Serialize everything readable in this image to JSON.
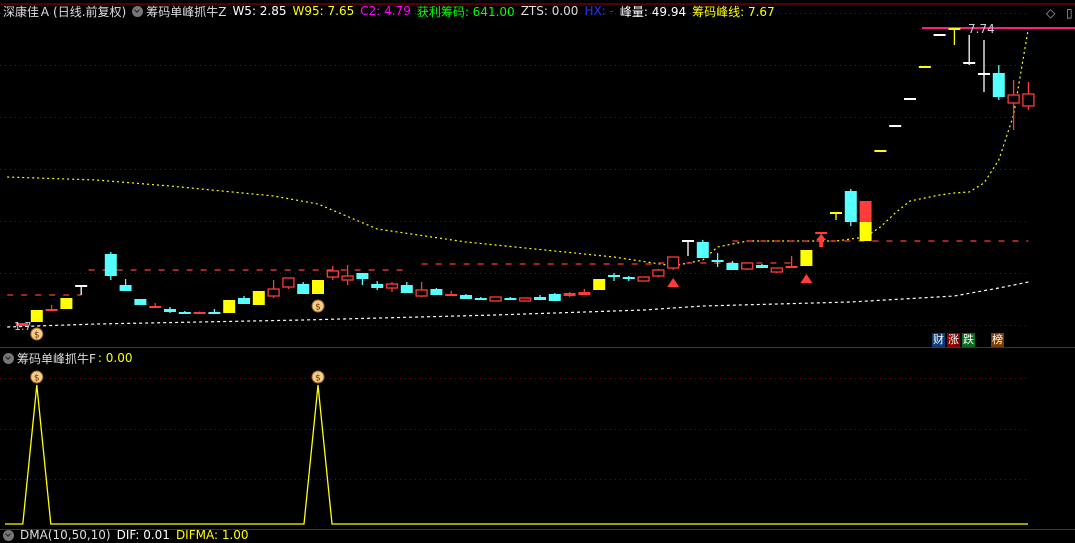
{
  "header": {
    "stock": "深康佳Ａ",
    "period": "(日线.前复权)",
    "indicator_name": "筹码单峰抓牛Z",
    "w5": "W5: 2.85",
    "w95": "W95: 7.65",
    "c2": "C2: 4.79",
    "profit_chips": "获利筹码: 641.00",
    "zts": "ZTS: 0.00",
    "hx": "HX: -",
    "peak_volume": "峰量: 49.94",
    "peak_line": "筹码峰线: 7.67"
  },
  "colors": {
    "up": "#ff3b3b",
    "down": "#55ffff",
    "yellow": "#ffff00",
    "white": "#ffffff",
    "magenta": "#ff1a8c",
    "grid": "#8b0000"
  },
  "main_chart": {
    "high_label": "7.74",
    "low_label": "1.7",
    "price_top": 8.3,
    "candles": [
      [
        1.84,
        1.78,
        1.84,
        1.78,
        "r"
      ],
      [
        2.1,
        1.86,
        2.1,
        1.86,
        "y"
      ],
      [
        2.12,
        2.08,
        2.2,
        2.08,
        "r"
      ],
      [
        2.34,
        2.12,
        2.34,
        2.12,
        "y"
      ],
      [
        2.6,
        2.58,
        2.6,
        2.4,
        "w"
      ],
      null,
      [
        3.22,
        2.78,
        3.26,
        2.7,
        "c"
      ],
      [
        2.6,
        2.48,
        2.72,
        2.48,
        "c"
      ],
      [
        2.32,
        2.2,
        2.32,
        2.2,
        "c"
      ],
      [
        2.18,
        2.14,
        2.24,
        2.14,
        "r"
      ],
      [
        2.12,
        2.06,
        2.16,
        2.04,
        "c"
      ],
      [
        2.06,
        2.04,
        2.08,
        2.02,
        "c"
      ],
      [
        2.06,
        2.04,
        2.07,
        2.03,
        "r"
      ],
      [
        2.06,
        2.04,
        2.12,
        2.04,
        "c"
      ],
      [
        2.3,
        2.04,
        2.3,
        2.04,
        "y"
      ],
      [
        2.34,
        2.22,
        2.38,
        2.22,
        "c"
      ],
      [
        2.48,
        2.2,
        2.48,
        2.2,
        "y"
      ],
      [
        2.52,
        2.38,
        2.7,
        2.34,
        "h"
      ],
      [
        2.74,
        2.56,
        2.74,
        2.52,
        "h"
      ],
      [
        2.62,
        2.42,
        2.66,
        2.42,
        "c"
      ],
      [
        2.7,
        2.42,
        2.7,
        2.42,
        "y"
      ],
      [
        2.88,
        2.76,
        2.98,
        2.7,
        "h"
      ],
      [
        2.78,
        2.7,
        3.0,
        2.6,
        "h"
      ],
      [
        2.84,
        2.72,
        2.84,
        2.6,
        "c"
      ],
      [
        2.62,
        2.54,
        2.68,
        2.5,
        "c"
      ],
      [
        2.62,
        2.54,
        2.66,
        2.46,
        "h"
      ],
      [
        2.6,
        2.44,
        2.66,
        2.44,
        "c"
      ],
      [
        2.5,
        2.38,
        2.66,
        2.36,
        "h"
      ],
      [
        2.52,
        2.4,
        2.54,
        2.4,
        "c"
      ],
      [
        2.42,
        2.38,
        2.48,
        2.38,
        "r"
      ],
      [
        2.4,
        2.32,
        2.42,
        2.32,
        "c"
      ],
      [
        2.34,
        2.3,
        2.36,
        2.3,
        "c"
      ],
      [
        2.36,
        2.28,
        2.36,
        2.28,
        "h"
      ],
      [
        2.34,
        2.3,
        2.36,
        2.3,
        "c"
      ],
      [
        2.34,
        2.28,
        2.34,
        2.28,
        "h"
      ],
      [
        2.36,
        2.3,
        2.4,
        2.3,
        "c"
      ],
      [
        2.42,
        2.28,
        2.44,
        2.28,
        "c"
      ],
      [
        2.44,
        2.38,
        2.46,
        2.36,
        "r"
      ],
      [
        2.46,
        2.4,
        2.52,
        2.4,
        "r"
      ],
      [
        2.72,
        2.5,
        2.72,
        2.5,
        "y"
      ],
      [
        2.8,
        2.76,
        2.84,
        2.68,
        "c"
      ],
      [
        2.76,
        2.72,
        2.78,
        2.68,
        "c"
      ],
      [
        2.76,
        2.68,
        2.76,
        2.68,
        "h"
      ],
      [
        2.9,
        2.78,
        2.92,
        2.76,
        "h"
      ],
      [
        3.16,
        2.94,
        3.16,
        2.9,
        "h"
      ],
      [
        3.5,
        3.48,
        3.5,
        3.18,
        "w"
      ],
      [
        3.46,
        3.14,
        3.5,
        3.14,
        "c"
      ],
      [
        3.1,
        3.06,
        3.24,
        2.96,
        "c"
      ],
      [
        3.04,
        2.9,
        3.08,
        2.9,
        "c"
      ],
      [
        3.04,
        2.92,
        3.04,
        2.9,
        "h"
      ],
      [
        3.0,
        2.94,
        3.02,
        2.94,
        "c"
      ],
      [
        2.94,
        2.86,
        2.94,
        2.84,
        "h"
      ],
      [
        2.98,
        2.96,
        3.18,
        2.96,
        "r"
      ],
      [
        3.3,
        2.98,
        3.3,
        2.98,
        "y"
      ],
      [
        3.66,
        3.64,
        3.66,
        3.46,
        "r"
      ],
      [
        4.06,
        4.04,
        4.06,
        3.9,
        "y"
      ],
      [
        4.48,
        3.86,
        4.52,
        3.78,
        "c"
      ],
      [
        4.28,
        3.48,
        4.28,
        3.48,
        "ry",
        3.86
      ],
      [
        5.3,
        5.28,
        5.3,
        5.28,
        "y"
      ],
      [
        5.8,
        5.78,
        5.8,
        5.78,
        "w"
      ],
      [
        6.34,
        6.32,
        6.34,
        6.32,
        "w"
      ],
      [
        6.98,
        6.96,
        6.98,
        6.96,
        "y"
      ],
      [
        7.62,
        7.6,
        7.62,
        7.6,
        "w"
      ],
      [
        7.74,
        7.72,
        7.74,
        7.4,
        "y"
      ],
      [
        7.06,
        7.04,
        7.6,
        7.0,
        "w"
      ],
      [
        6.84,
        6.82,
        7.5,
        6.46,
        "w"
      ],
      [
        6.84,
        6.36,
        7.0,
        6.3,
        "c"
      ],
      [
        6.4,
        6.24,
        6.7,
        5.7,
        "h"
      ],
      [
        6.42,
        6.18,
        6.66,
        6.1,
        "h"
      ]
    ],
    "upper_band": [
      [
        -1,
        4.76
      ],
      [
        5,
        4.7
      ],
      [
        10,
        4.58
      ],
      [
        17,
        4.38
      ],
      [
        20,
        4.22
      ],
      [
        24,
        3.72
      ],
      [
        30,
        3.46
      ],
      [
        40,
        3.16
      ],
      [
        44,
        2.98
      ],
      [
        46,
        3.1
      ],
      [
        47,
        3.36
      ],
      [
        49,
        3.48
      ],
      [
        55,
        3.48
      ],
      [
        57,
        3.56
      ],
      [
        58,
        3.76
      ],
      [
        59,
        4.04
      ],
      [
        60,
        4.28
      ],
      [
        61,
        4.34
      ],
      [
        62,
        4.4
      ],
      [
        63,
        4.44
      ],
      [
        64,
        4.46
      ],
      [
        65,
        4.64
      ],
      [
        66,
        5.1
      ],
      [
        67,
        6.0
      ],
      [
        68,
        7.74
      ]
    ],
    "lower_band": [
      [
        -1,
        1.76
      ],
      [
        5,
        1.82
      ],
      [
        19,
        1.9
      ],
      [
        32,
        2.0
      ],
      [
        42,
        2.1
      ],
      [
        46,
        2.18
      ],
      [
        56,
        2.26
      ],
      [
        63,
        2.38
      ],
      [
        66,
        2.54
      ],
      [
        68,
        2.66
      ]
    ],
    "dash_lines": [
      [
        -1,
        4,
        2.4
      ],
      [
        4.5,
        26,
        2.9
      ],
      [
        27,
        43,
        3.02
      ],
      [
        43,
        52,
        3.04
      ],
      [
        48,
        68,
        3.48
      ]
    ],
    "triangles": [
      44,
      53
    ],
    "arrows": [
      54
    ],
    "money_bag_idx": [
      1,
      20
    ],
    "badges": [
      "财",
      "涨",
      "跌",
      "榜"
    ]
  },
  "sub_chart": {
    "title": "筹码单峰抓牛F",
    "value": ": 0.00",
    "spike_idx": [
      1,
      20
    ]
  },
  "bottom": {
    "name": "DMA(10,50,10)",
    "dif": "DIF: 0.01",
    "difma": "DIFMA: 1.00"
  }
}
